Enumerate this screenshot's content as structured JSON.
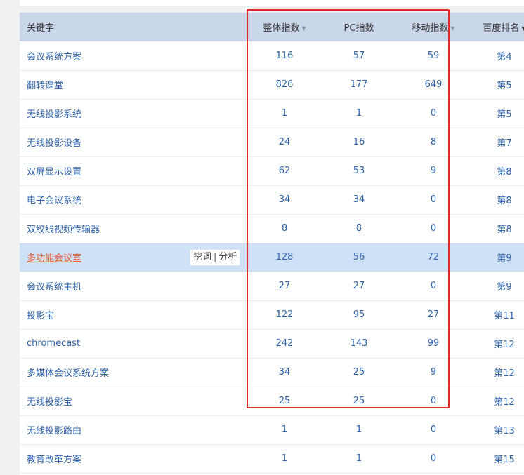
{
  "table": {
    "headers": {
      "keyword": "关键字",
      "overall": "整体指数",
      "pc": "PC指数",
      "mobile": "移动指数",
      "rank": "百度排名"
    },
    "row_actions": {
      "dig": "挖词",
      "sep": "|",
      "analyze": "分析"
    },
    "rows": [
      {
        "keyword": "会议系统方案",
        "overall": "116",
        "pc": "57",
        "mobile": "59",
        "rank": "第4"
      },
      {
        "keyword": "翻转课堂",
        "overall": "826",
        "pc": "177",
        "mobile": "649",
        "rank": "第5"
      },
      {
        "keyword": "无线投影系统",
        "overall": "1",
        "pc": "1",
        "mobile": "0",
        "rank": "第5"
      },
      {
        "keyword": "无线投影设备",
        "overall": "24",
        "pc": "16",
        "mobile": "8",
        "rank": "第7"
      },
      {
        "keyword": "双屏显示设置",
        "overall": "62",
        "pc": "53",
        "mobile": "9",
        "rank": "第8"
      },
      {
        "keyword": "电子会议系统",
        "overall": "34",
        "pc": "34",
        "mobile": "0",
        "rank": "第8"
      },
      {
        "keyword": "双绞线视频传输器",
        "overall": "8",
        "pc": "8",
        "mobile": "0",
        "rank": "第8"
      },
      {
        "keyword": "多功能会议室",
        "overall": "128",
        "pc": "56",
        "mobile": "72",
        "rank": "第9"
      },
      {
        "keyword": "会议系统主机",
        "overall": "27",
        "pc": "27",
        "mobile": "0",
        "rank": "第9"
      },
      {
        "keyword": "投影宝",
        "overall": "122",
        "pc": "95",
        "mobile": "27",
        "rank": "第11"
      },
      {
        "keyword": "chromecast",
        "overall": "242",
        "pc": "143",
        "mobile": "99",
        "rank": "第12"
      },
      {
        "keyword": "多媒体会议系统方案",
        "overall": "34",
        "pc": "25",
        "mobile": "9",
        "rank": "第12"
      },
      {
        "keyword": "无线投影宝",
        "overall": "25",
        "pc": "25",
        "mobile": "0",
        "rank": "第12"
      },
      {
        "keyword": "无线投影路由",
        "overall": "1",
        "pc": "1",
        "mobile": "0",
        "rank": "第13"
      },
      {
        "keyword": "教育改革方案",
        "overall": "1",
        "pc": "1",
        "mobile": "0",
        "rank": "第15"
      }
    ]
  },
  "colors": {
    "header_bg": "#cad6ea",
    "link": "#2c62a8",
    "hover_row_bg": "#cfe1f7",
    "hover_keyword": "#e4572e",
    "annotation_frame": "#e02a2a"
  },
  "icons": {
    "sort": "caret-down-icon"
  }
}
